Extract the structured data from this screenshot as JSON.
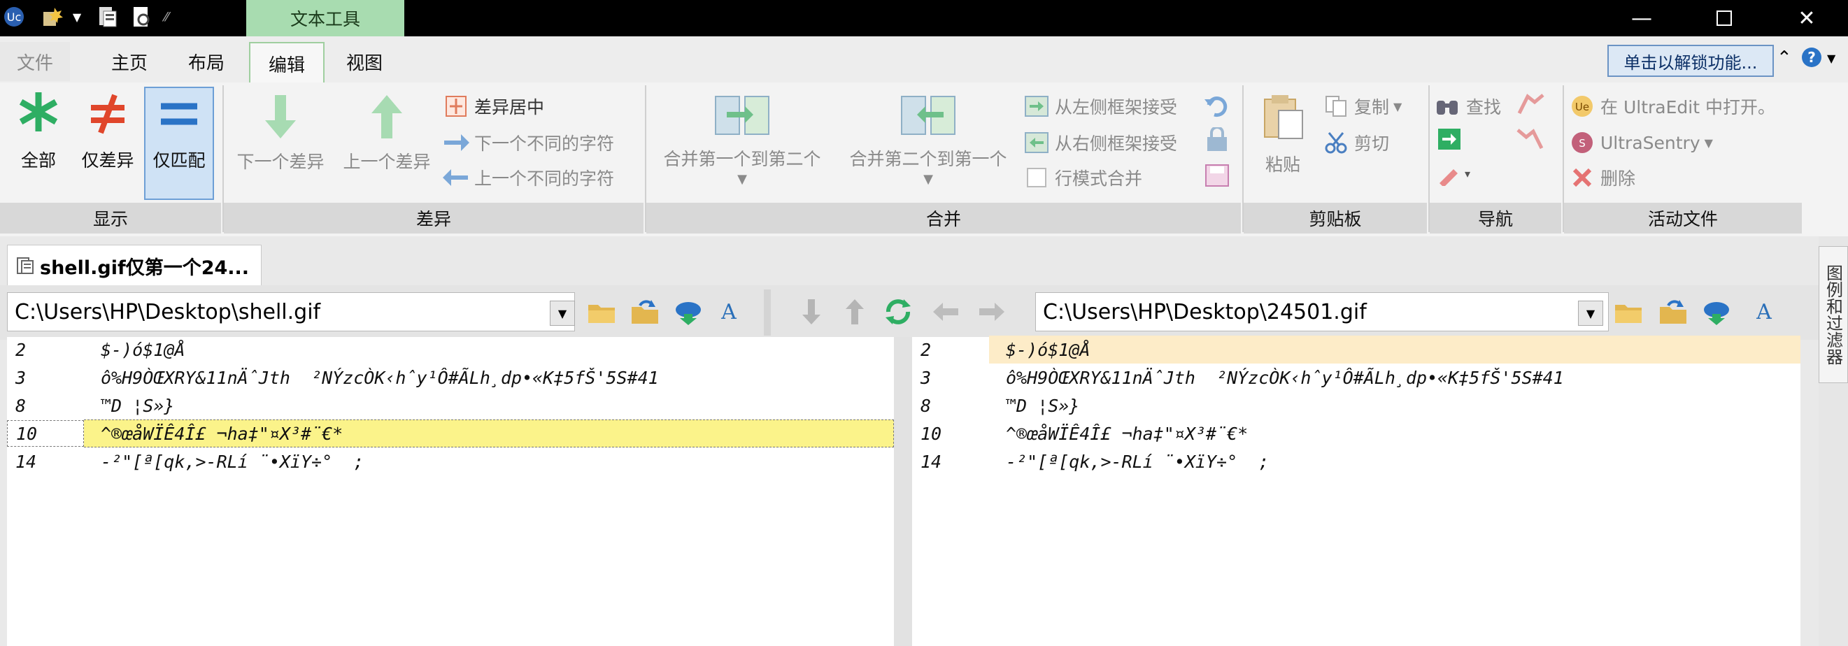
{
  "ribbon_tabs": {
    "file": "文件",
    "home": "主页",
    "layout": "布局",
    "edit": "编辑",
    "view": "视图",
    "context": "文本工具"
  },
  "unlock": "单击以解锁功能...",
  "groups": {
    "display": {
      "label": "显示",
      "all": "全部",
      "diff_only": "仅差异",
      "match_only": "仅匹配"
    },
    "diff": {
      "label": "差异",
      "next_diff": "下一个差异",
      "prev_diff": "上一个差异",
      "center_diff": "差异居中",
      "next_char": "下一个不同的字符",
      "prev_char": "上一个不同的字符"
    },
    "merge": {
      "label": "合并",
      "merge_1_to_2": "合并第一个到第二个",
      "merge_2_to_1": "合并第二个到第一个",
      "accept_left": "从左侧框架接受",
      "accept_right": "从右侧框架接受",
      "line_mode": "行模式合并"
    },
    "clipboard": {
      "label": "剪贴板",
      "paste": "粘贴",
      "copy": "复制",
      "cut": "剪切"
    },
    "nav": {
      "label": "导航",
      "find": "查找"
    },
    "active_file": {
      "label": "活动文件",
      "open_ue": "在 UltraEdit 中打开。",
      "sentry": "UltraSentry",
      "delete": "删除"
    }
  },
  "doc_tab": "shell.gif仅第一个24...",
  "side_label": "图例和过滤器",
  "left_path": "C:\\Users\\HP\\Desktop\\shell.gif",
  "right_path": "C:\\Users\\HP\\Desktop\\24501.gif",
  "left_lines": [
    {
      "n": "2",
      "t": "$-)ó$1@Å "
    },
    {
      "n": "3",
      "t": "ô%H9ÒŒXRY&11nÄˆJth  ²NÝzcÒK‹hˆy¹Ô#ÃLh¸dp•«K‡5fŠ'5S#41"
    },
    {
      "n": "8",
      "t": "™D ¦S»}"
    },
    {
      "n": "10",
      "t": "^®œåWÏÊ4Î£ ¬ha‡\"¤X³#¨€*"
    },
    {
      "n": "14",
      "t": "-²\"[ª[qk,>-RLí ¨•XïY÷°  ;"
    }
  ],
  "right_lines": [
    {
      "n": "2",
      "t": "$-)ó$1@Å "
    },
    {
      "n": "3",
      "t": "ô%H9ÒŒXRY&11nÄˆJth  ²NÝzcÒK‹hˆy¹Ô#ÃLh¸dp•«K‡5fŠ'5S#41"
    },
    {
      "n": "8",
      "t": "™D ¦S»}"
    },
    {
      "n": "10",
      "t": "^®œåWÏÊ4Î£ ¬ha‡\"¤X³#¨€*"
    },
    {
      "n": "14",
      "t": "-²\"[ª[qk,>-RLí ¨•XïY÷°  ;"
    }
  ],
  "colors": {
    "highlight_current": "#fbf38a",
    "highlight_right": "#fdecc8",
    "accent_green": "#2eae63",
    "accent_red": "#e0462b",
    "accent_blue": "#2a73c6"
  }
}
